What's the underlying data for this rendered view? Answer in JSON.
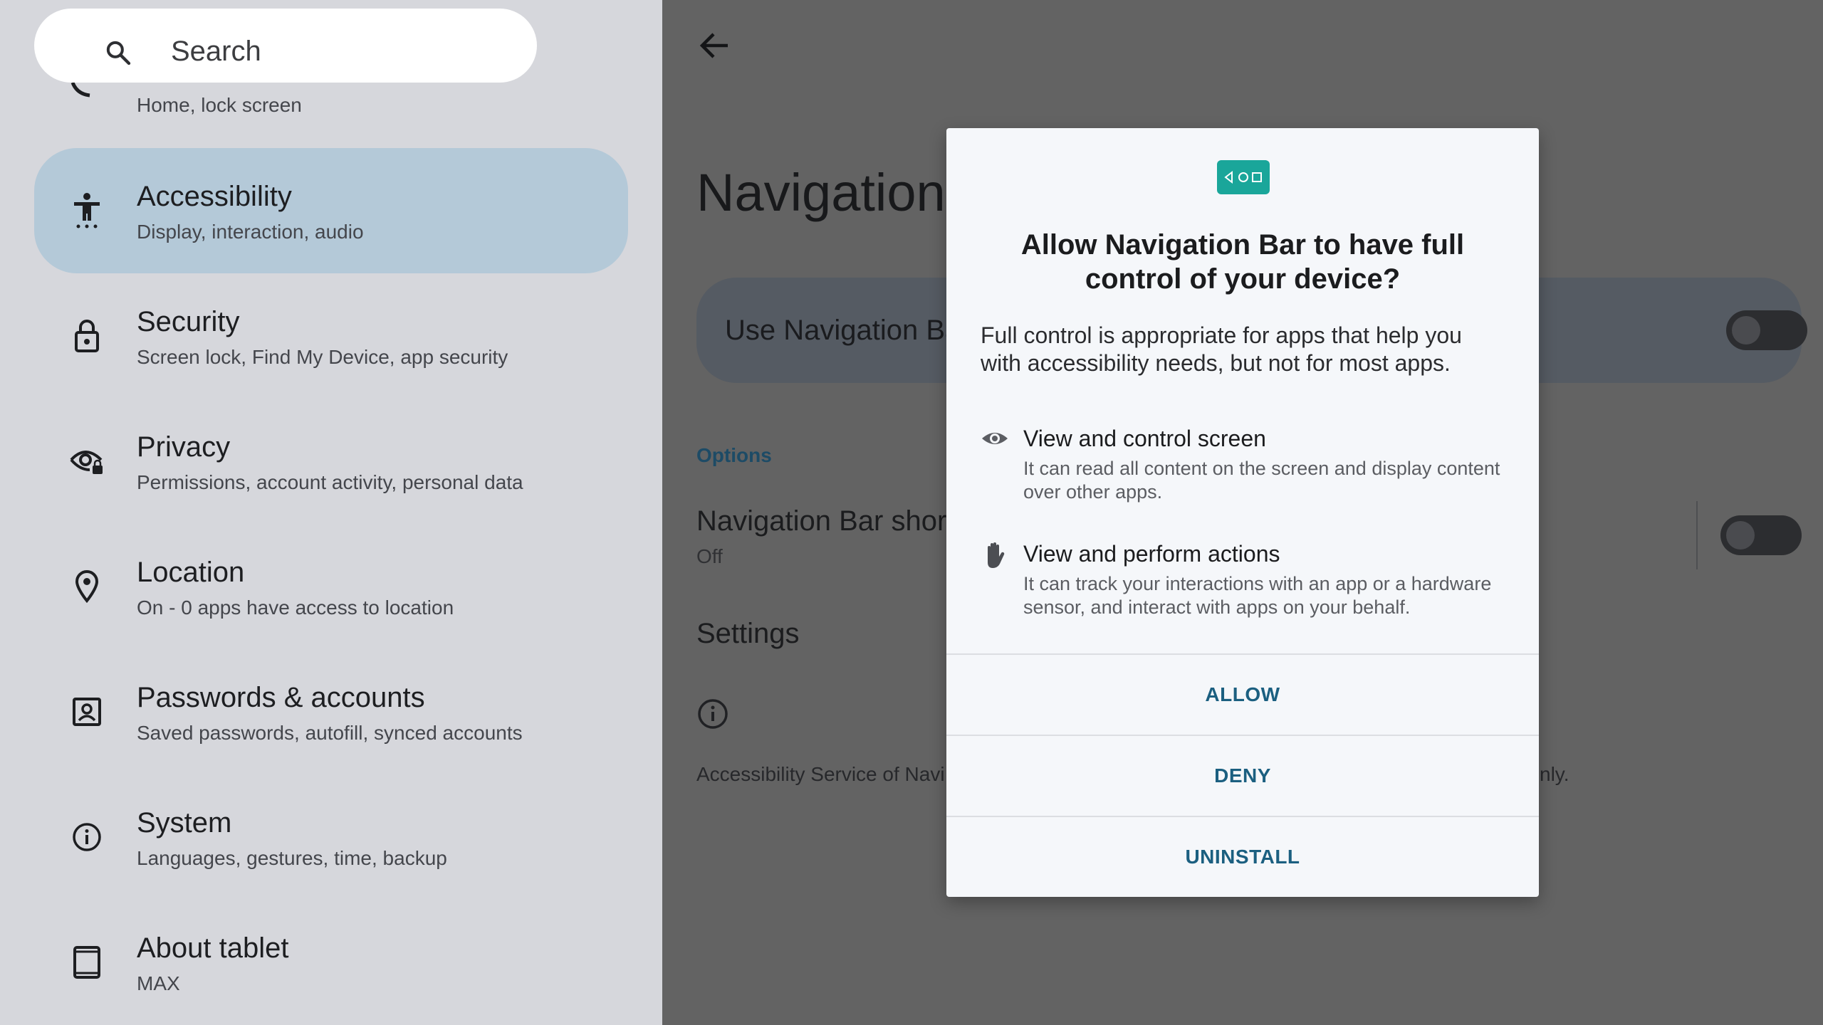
{
  "search": {
    "placeholder": "Search"
  },
  "sidebar": {
    "partial_item": {
      "subtitle": "Home, lock screen"
    },
    "items": [
      {
        "title": "Accessibility",
        "subtitle": "Display, interaction, audio",
        "icon": "accessibility-icon",
        "active": true
      },
      {
        "title": "Security",
        "subtitle": "Screen lock, Find My Device, app security",
        "icon": "lock-icon"
      },
      {
        "title": "Privacy",
        "subtitle": "Permissions, account activity, personal data",
        "icon": "privacy-eye-icon"
      },
      {
        "title": "Location",
        "subtitle": "On - 0 apps have access to location",
        "icon": "location-pin-icon"
      },
      {
        "title": "Passwords & accounts",
        "subtitle": "Saved passwords, autofill, synced accounts",
        "icon": "account-box-icon"
      },
      {
        "title": "System",
        "subtitle": "Languages, gestures, time, backup",
        "icon": "info-icon"
      },
      {
        "title": "About tablet",
        "subtitle": "MAX",
        "icon": "tablet-icon"
      }
    ]
  },
  "detail": {
    "title": "Navigation",
    "use_toggle_label": "Use Navigation Ba",
    "options_header": "Options",
    "shortcut_title": "Navigation Bar shor",
    "shortcut_value": "Off",
    "settings_header": "Settings",
    "description_left": "Accessibility Service of Navi",
    "description_right": "nly."
  },
  "dialog": {
    "title": "Allow Navigation Bar to have full control of your device?",
    "body": "Full control is appropriate for apps that help you with accessibility needs, but not for most apps.",
    "permissions": [
      {
        "title": "View and control screen",
        "description": "It can read all content on the screen and display content over other apps.",
        "icon": "eye-icon"
      },
      {
        "title": "View and perform actions",
        "description": "It can track your interactions with an app or a hardware sensor, and interact with apps on your behalf.",
        "icon": "hand-icon"
      }
    ],
    "buttons": {
      "allow": "ALLOW",
      "deny": "DENY",
      "uninstall": "UNINSTALL"
    }
  },
  "colors": {
    "accent": "#1b5f80",
    "selected_item_bg": "#b4c9d8",
    "app_icon_bg": "#1aa69a"
  }
}
